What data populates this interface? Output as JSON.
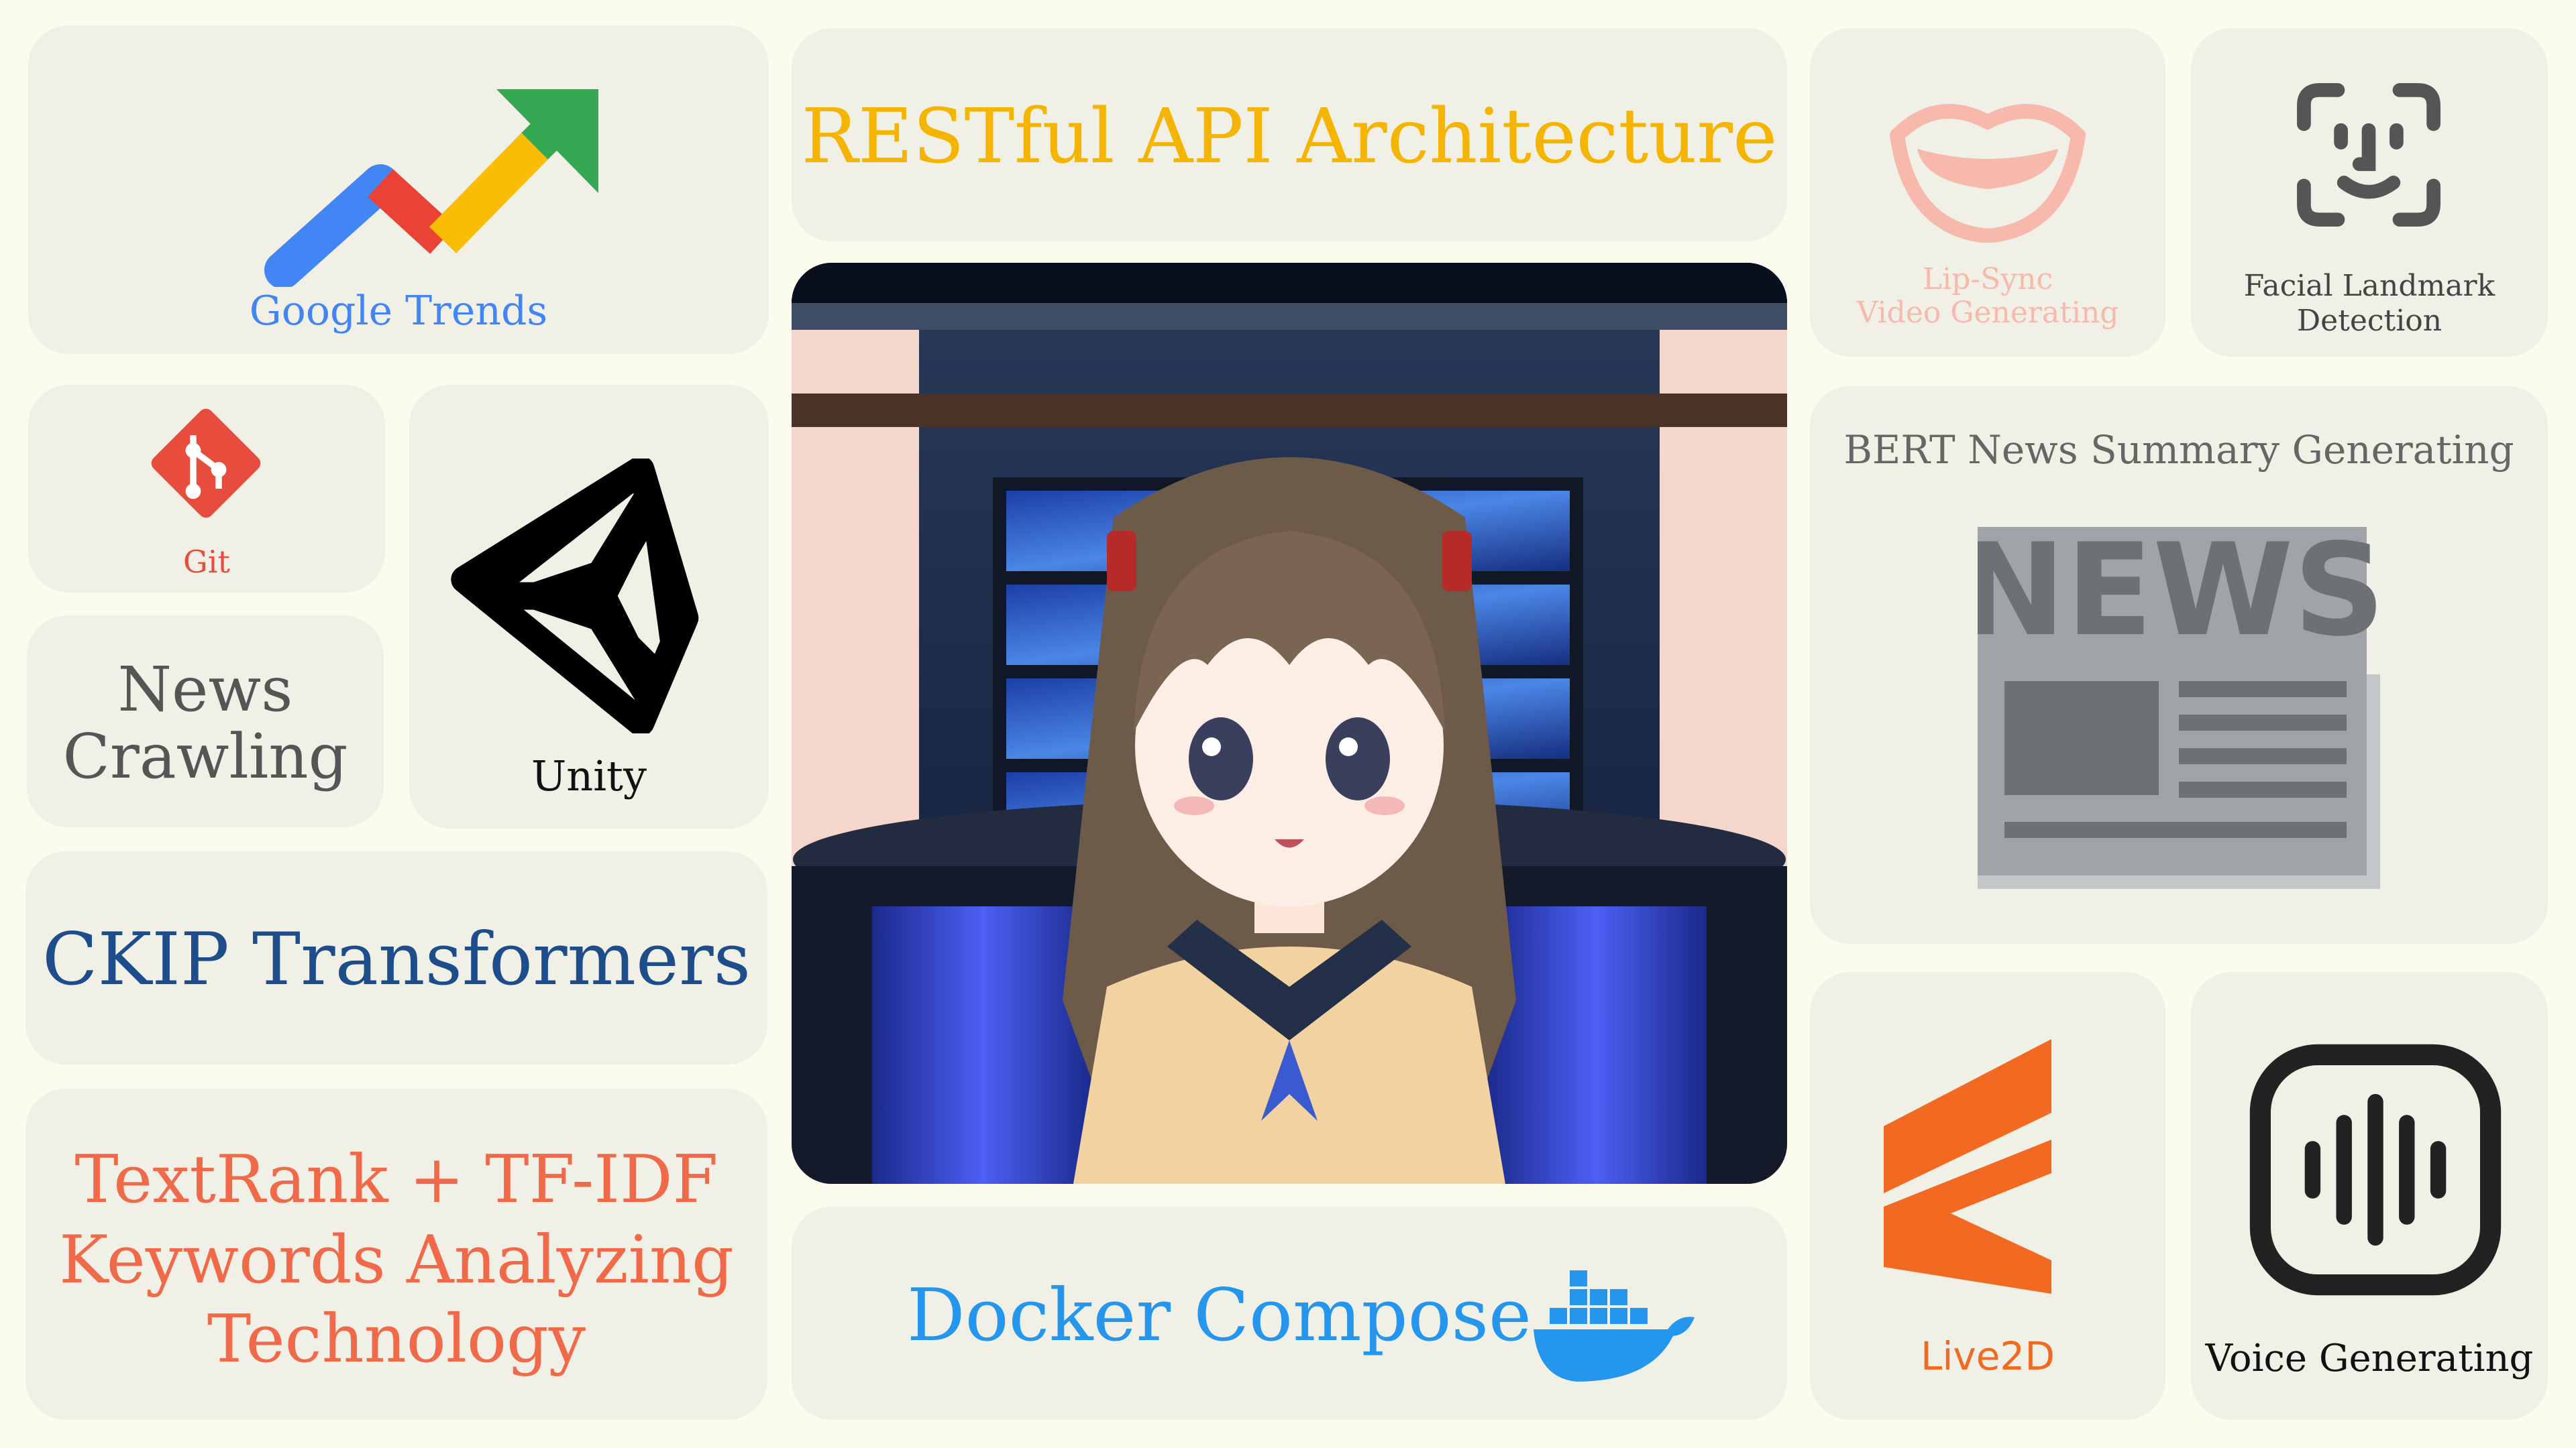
{
  "colors": {
    "background": "#fcfcee",
    "card": "#f1f0e6",
    "google_blue": "#4285f4",
    "git_red": "#e74c3c",
    "restful_yellow": "#f4b400",
    "ckip_blue": "#1e4d8c",
    "textrank_coral": "#f06a4a",
    "docker_blue": "#2496ed",
    "lipsync_pink": "#f7b9ac",
    "landmark_gray": "#555555",
    "bert_gray": "#666666",
    "live2d_orange": "#f26a21",
    "voice_black": "#222222"
  },
  "tiles": {
    "google_trends": {
      "label": "Google Trends",
      "icon": "trending-up-icon"
    },
    "git": {
      "label": "Git",
      "icon": "git-logo-icon"
    },
    "unity": {
      "label": "Unity",
      "icon": "unity-logo-icon"
    },
    "news_crawling": {
      "line1": "News",
      "line2": "Crawling"
    },
    "ckip": {
      "label": "CKIP Transformers"
    },
    "textrank": {
      "line1": "TextRank + TF-IDF",
      "line2": "Keywords Analyzing",
      "line3": "Technology"
    },
    "restful": {
      "label": "RESTful API Architecture"
    },
    "docker": {
      "label": "Docker Compose",
      "icon": "docker-whale-icon"
    },
    "lipsync": {
      "line1": "Lip-Sync",
      "line2": "Video Generating",
      "icon": "mouth-icon"
    },
    "landmark": {
      "line1": "Facial Landmark",
      "line2": "Detection",
      "icon": "face-scan-icon"
    },
    "bert": {
      "label": "BERT News Summary Generating",
      "icon": "newspaper-icon",
      "icon_text": "NEWS"
    },
    "live2d": {
      "label": "Live2D",
      "icon": "live2d-logo-icon"
    },
    "voice": {
      "label": "Voice Generating",
      "icon": "voice-wave-icon"
    }
  },
  "center": {
    "image": "anime-news-anchor-illustration"
  }
}
